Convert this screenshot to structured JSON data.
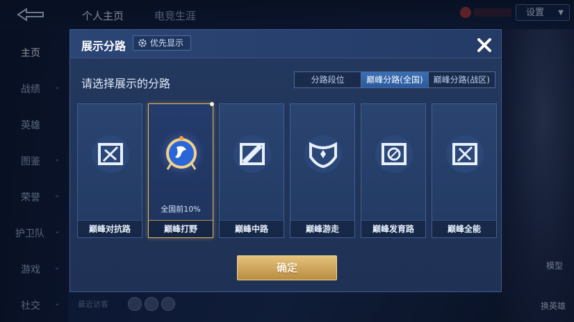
{
  "background": {
    "tabs": [
      "个人主页",
      "电竞生涯"
    ],
    "settings_label": "设置",
    "nav_items": [
      "主页",
      "战绩",
      "英雄",
      "图鉴",
      "荣誉",
      "护卫队",
      "游戏",
      "社交"
    ],
    "right_labels": [
      "模型",
      "换英雄"
    ],
    "recent_visitors_label": "最近访客"
  },
  "dialog": {
    "title": "展示分路",
    "priority_label": "优先显示",
    "prompt": "请选择展示的分路",
    "seg_tabs": [
      {
        "label": "分路段位",
        "active": false
      },
      {
        "label": "巅峰分路(全国)",
        "active": true
      },
      {
        "label": "巅峰分路(战区)",
        "active": false
      }
    ],
    "cards": [
      {
        "name": "巅峰对抗路",
        "rank": "",
        "selected": false,
        "icon": "sword-lane-icon"
      },
      {
        "name": "巅峰打野",
        "rank": "全国前10%",
        "selected": true,
        "icon": "jungle-emblem-icon"
      },
      {
        "name": "巅峰中路",
        "rank": "",
        "selected": false,
        "icon": "mid-lane-icon"
      },
      {
        "name": "巅峰游走",
        "rank": "",
        "selected": false,
        "icon": "support-wings-icon"
      },
      {
        "name": "巅峰发育路",
        "rank": "",
        "selected": false,
        "icon": "marksman-lane-icon"
      },
      {
        "name": "巅峰全能",
        "rank": "",
        "selected": false,
        "icon": "all-round-icon"
      }
    ],
    "confirm_label": "确定"
  },
  "colors": {
    "accent_gold": "#e6b866",
    "active_tab": "#3b6fb4",
    "panel": "#24395f"
  }
}
